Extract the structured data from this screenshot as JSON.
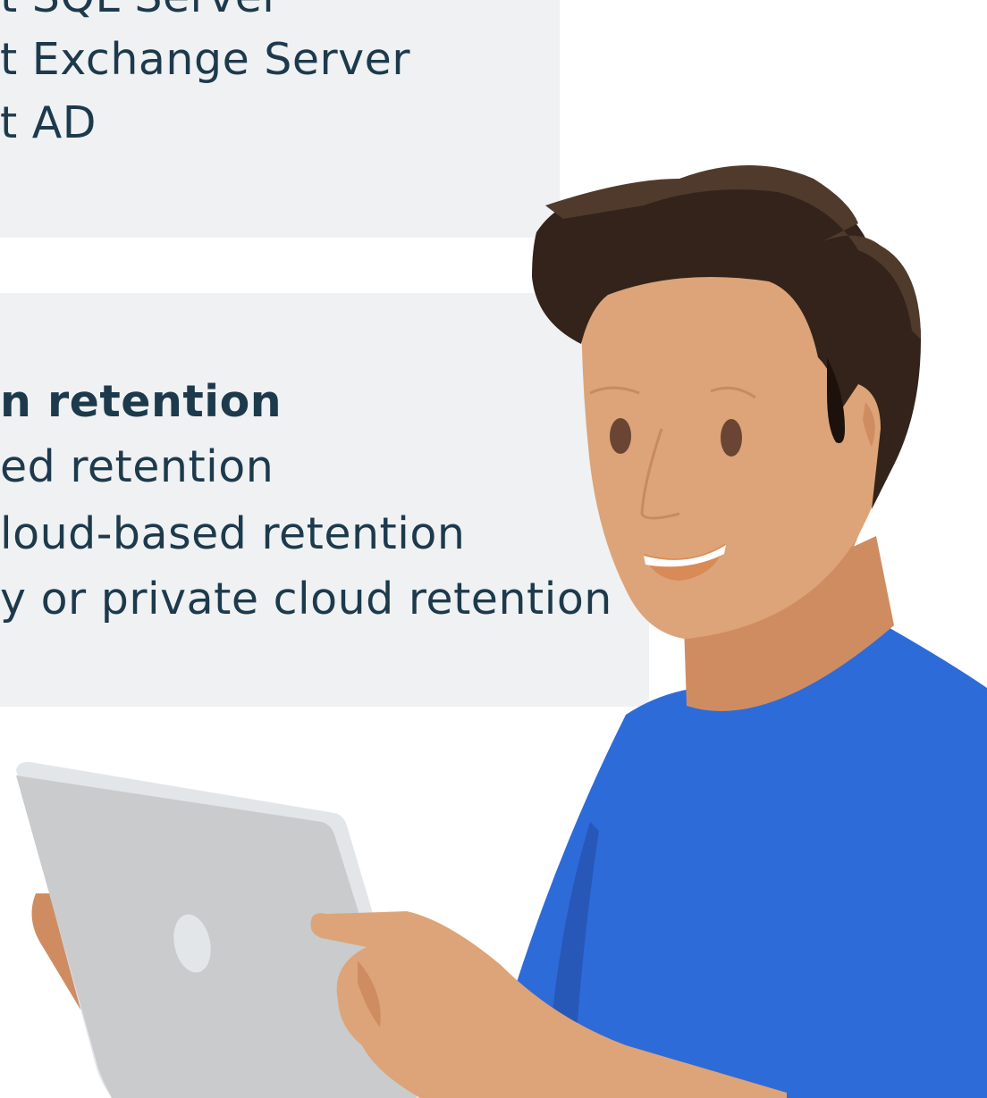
{
  "card_top": {
    "lines": [
      "t SQL Server",
      "t Exchange Server",
      "t AD"
    ]
  },
  "card_bottom": {
    "heading": "n retention",
    "lines": [
      "ed retention",
      "loud-based retention",
      "y or private cloud retention"
    ]
  },
  "illustration": {
    "subject": "person-holding-tablet",
    "colors": {
      "shirt": "#2d6bd9",
      "skin": "#dca478",
      "skin_shadow": "#d08c61",
      "hair": "#33231a",
      "hair_highlight": "#4f3a2c",
      "tablet": "#c9cbcc",
      "tablet_edge": "#e3e6e9",
      "card_bg": "#eff1f3",
      "text": "#1d3a4c"
    }
  }
}
